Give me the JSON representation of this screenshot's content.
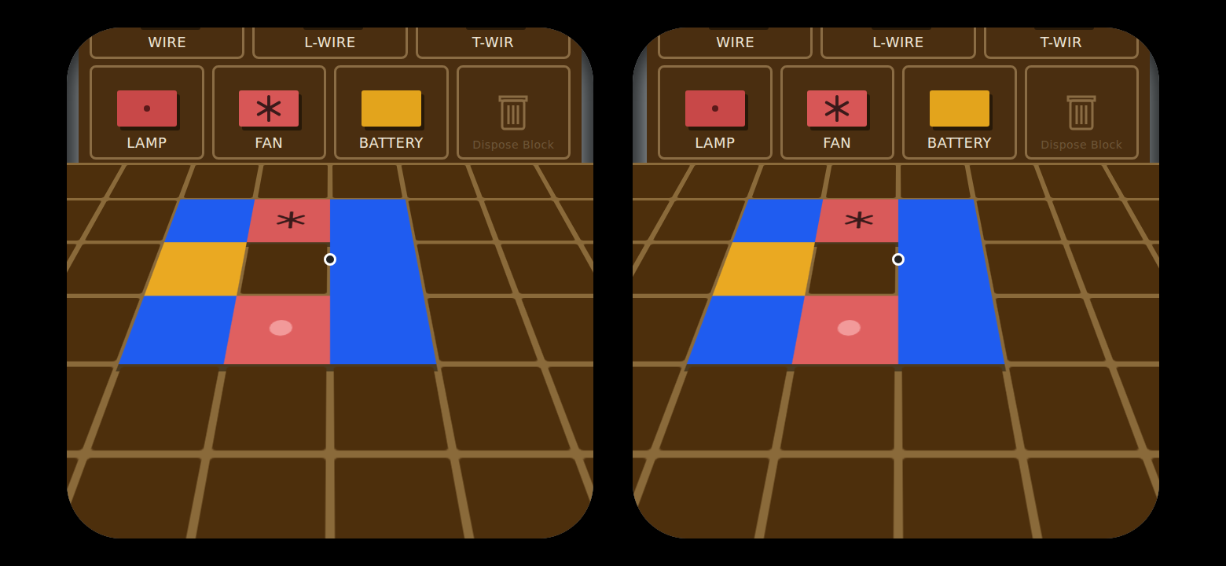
{
  "eyes": [
    "left",
    "right"
  ],
  "palette": {
    "rows": [
      [
        {
          "label": "WIRE",
          "kind": "wire"
        },
        {
          "label": "L-WIRE",
          "kind": "l-wire"
        },
        {
          "label": "T-WIR",
          "kind": "t-wire"
        }
      ],
      [
        {
          "label": "LAMP",
          "kind": "lamp"
        },
        {
          "label": "FAN",
          "kind": "fan"
        },
        {
          "label": "BATTERY",
          "kind": "battery"
        },
        {
          "label": "Dispose Block",
          "kind": "trash"
        }
      ]
    ]
  },
  "board": {
    "rows": [
      [
        "empty",
        "empty",
        "empty",
        "empty",
        "empty",
        "empty",
        "empty",
        "empty"
      ],
      [
        "empty",
        "empty",
        "l-wire",
        "fan",
        "l-wire",
        "empty",
        "empty",
        "empty"
      ],
      [
        "empty",
        "empty",
        "battery",
        "empty",
        "wire",
        "empty",
        "empty",
        "empty"
      ],
      [
        "empty",
        "empty",
        "l-wire",
        "lamp",
        "l-wire",
        "empty",
        "empty",
        "empty"
      ],
      [
        "empty",
        "empty",
        "empty",
        "empty",
        "empty",
        "empty",
        "empty",
        "empty"
      ],
      [
        "empty",
        "empty",
        "empty",
        "empty",
        "empty",
        "empty",
        "empty",
        "empty"
      ]
    ]
  }
}
